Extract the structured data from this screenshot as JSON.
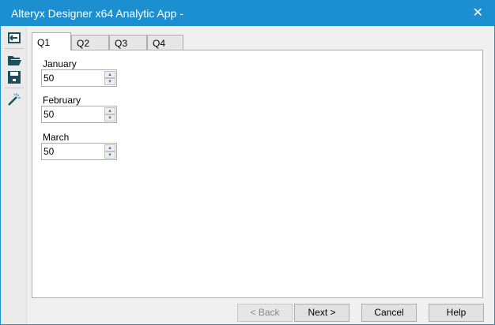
{
  "window": {
    "title": "Alteryx Designer x64 Analytic App -",
    "close_icon": "close-icon"
  },
  "sidebar": {
    "icons": [
      "exit-icon",
      "open-folder-icon",
      "save-icon",
      "magic-wand-icon"
    ]
  },
  "tabs": [
    {
      "label": "Q1"
    },
    {
      "label": "Q2"
    },
    {
      "label": "Q3"
    },
    {
      "label": "Q4"
    }
  ],
  "fields": [
    {
      "label": "January",
      "value": "50"
    },
    {
      "label": "February",
      "value": "50"
    },
    {
      "label": "March",
      "value": "50"
    }
  ],
  "buttons": {
    "back": "< Back",
    "next": "Next >",
    "cancel": "Cancel",
    "help": "Help"
  },
  "colors": {
    "accent": "#1c8fd1",
    "icon": "#1f4e5a"
  }
}
